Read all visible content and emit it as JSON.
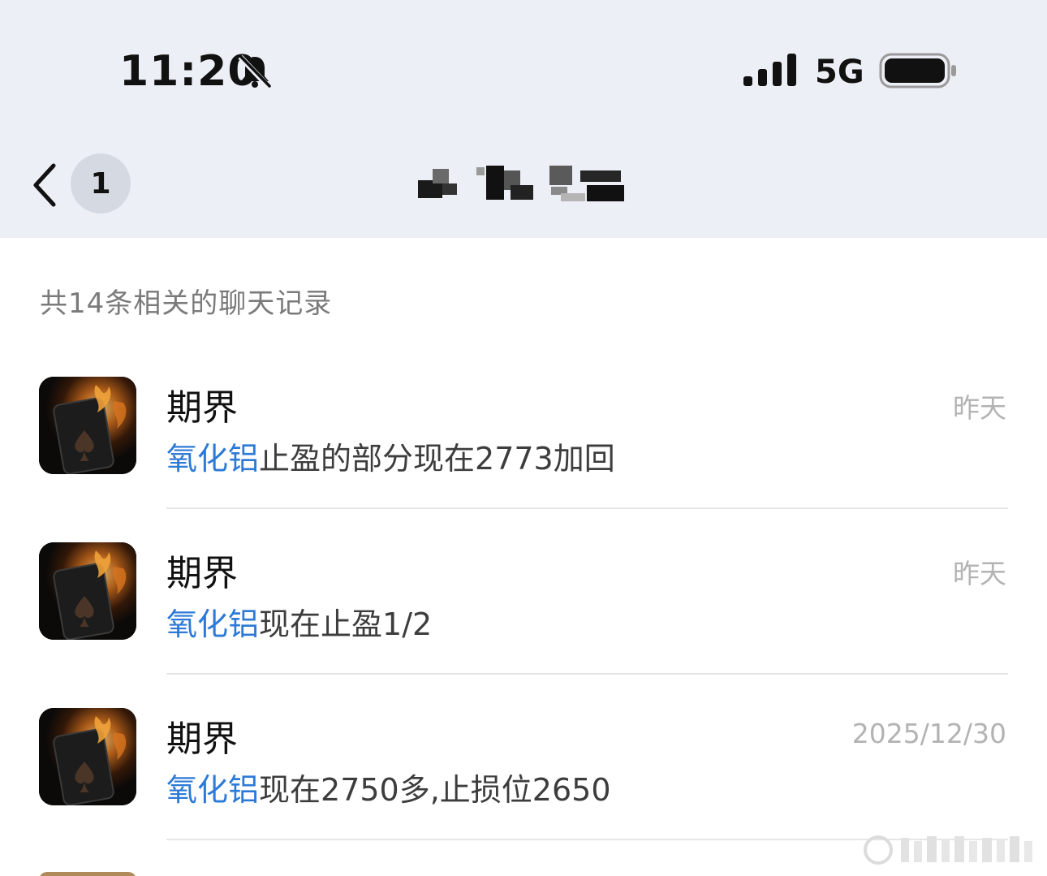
{
  "status_bar": {
    "time": "11:20",
    "network": "5G"
  },
  "nav": {
    "back_count": "1"
  },
  "summary": "共14条相关的聊天记录",
  "results": [
    {
      "sender": "期界",
      "date": "昨天",
      "keyword": "氧化铝",
      "message": "止盈的部分现在2773加回"
    },
    {
      "sender": "期界",
      "date": "昨天",
      "keyword": "氧化铝",
      "message": "现在止盈1/2"
    },
    {
      "sender": "期界",
      "date": "2025/12/30",
      "keyword": "氧化铝",
      "message": "现在2750多,止损位2650"
    }
  ],
  "colors": {
    "header_bg": "#eceff6",
    "keyword": "#2d7ad6",
    "secondary_text": "#b3b3b3"
  }
}
